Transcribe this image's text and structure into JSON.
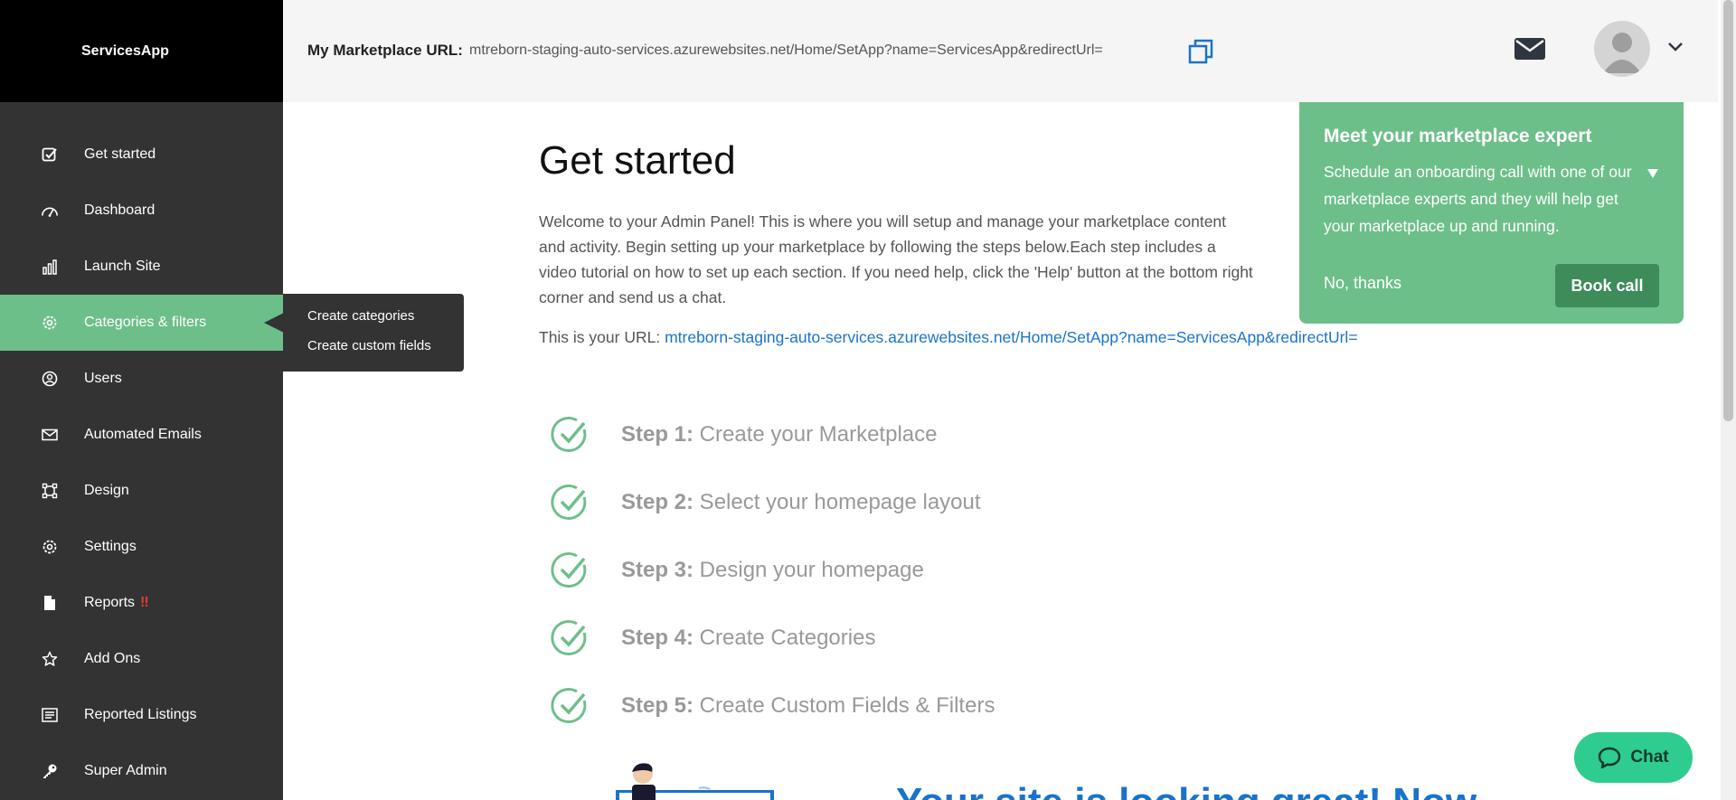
{
  "sidebar": {
    "brand": "ServicesApp",
    "items": [
      {
        "label": "Get started",
        "icon": "checkbox-icon"
      },
      {
        "label": "Dashboard",
        "icon": "speedometer-icon"
      },
      {
        "label": "Launch Site",
        "icon": "bar-chart-icon"
      },
      {
        "label": "Categories & filters",
        "icon": "gear-icon",
        "active": true
      },
      {
        "label": "Users",
        "icon": "user-circle-icon"
      },
      {
        "label": "Automated Emails",
        "icon": "envelope-icon"
      },
      {
        "label": "Design",
        "icon": "frame-icon"
      },
      {
        "label": "Settings",
        "icon": "gear-icon"
      },
      {
        "label": "Reports",
        "icon": "document-icon",
        "badge": "!!"
      },
      {
        "label": "Add Ons",
        "icon": "star-icon"
      },
      {
        "label": "Reported Listings",
        "icon": "list-icon"
      },
      {
        "label": "Super Admin",
        "icon": "key-icon"
      }
    ],
    "flyout": [
      "Create categories",
      "Create custom fields"
    ]
  },
  "header": {
    "url_label": "My Marketplace URL:",
    "url_value": "mtreborn-staging-auto-services.azurewebsites.net/Home/SetApp?name=ServicesApp&redirectUrl="
  },
  "main": {
    "title": "Get started",
    "intro": "Welcome to your Admin Panel! This is where you will setup and manage your marketplace content and activity. Begin setting up your marketplace by following the steps below.Each step includes a video tutorial on how to set up each section. If you need help, click the 'Help' button at the bottom right corner and send us a chat.",
    "url_prefix": "This is your URL: ",
    "url_link": "mtreborn-staging-auto-services.azurewebsites.net/Home/SetApp?name=ServicesApp&redirectUrl=",
    "steps": [
      {
        "label": "Step 1:",
        "text": " Create your Marketplace"
      },
      {
        "label": "Step 2:",
        "text": " Select your homepage layout"
      },
      {
        "label": "Step 3:",
        "text": " Design your homepage"
      },
      {
        "label": "Step 4:",
        "text": " Create Categories"
      },
      {
        "label": "Step 5:",
        "text": " Create Custom Fields & Filters"
      }
    ],
    "bottom_heading": "Your site is looking great! Now"
  },
  "expert": {
    "title": "Meet your marketplace expert",
    "body": "Schedule an onboarding call with one of our marketplace experts and they will help get your marketplace up and running.",
    "no_thanks": "No, thanks",
    "book_call": "Book call"
  },
  "chat": {
    "label": "Chat"
  },
  "colors": {
    "sidebar": "#333333",
    "brand_bar": "#000000",
    "accent_green": "#6dbf8a",
    "book_call": "#3d8c5a",
    "link_blue": "#1a73c8",
    "chat_green": "#2ecc8f",
    "warning_red": "#e53935"
  }
}
